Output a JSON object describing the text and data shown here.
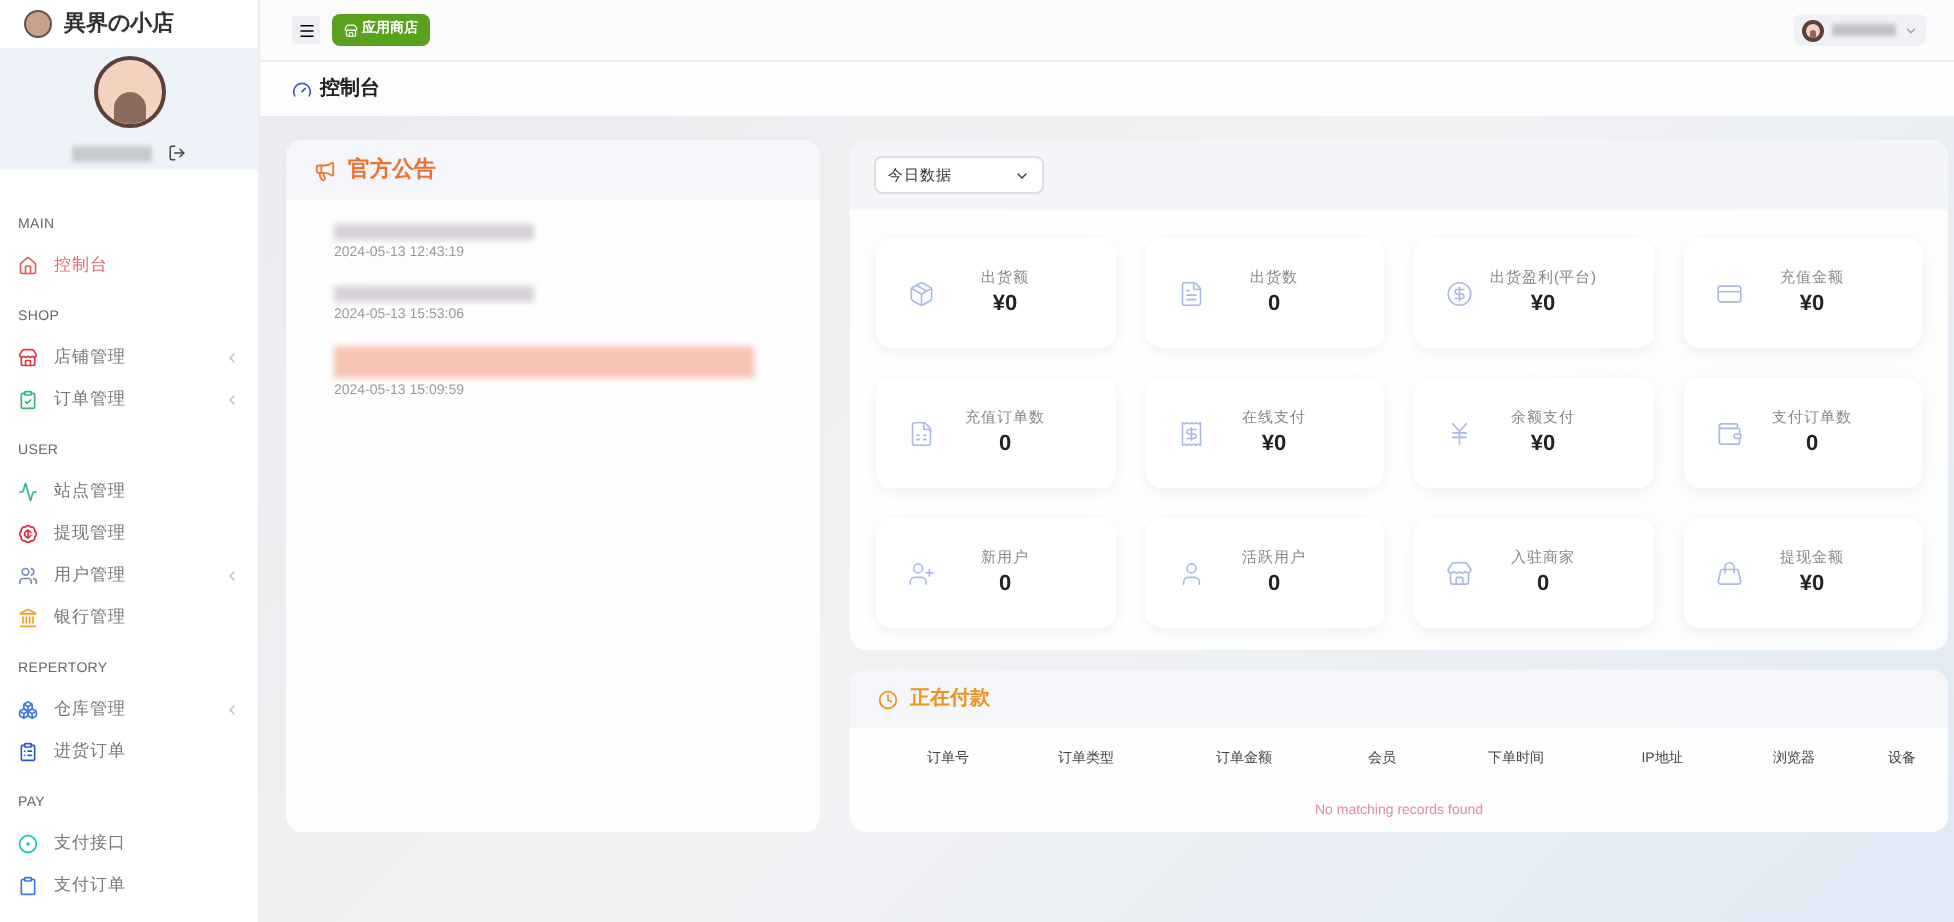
{
  "brand": {
    "title": "異界の小店"
  },
  "topbar": {
    "store_button": "应用商店"
  },
  "breadcrumb": {
    "title": "控制台"
  },
  "sidebar": {
    "sections": [
      {
        "heading": "MAIN",
        "items": [
          {
            "label": "控制台",
            "selected": true,
            "expandable": false,
            "color": "#e05a5a"
          }
        ]
      },
      {
        "heading": "SHOP",
        "items": [
          {
            "label": "店铺管理",
            "selected": false,
            "expandable": true,
            "color": "#e0383e"
          },
          {
            "label": "订单管理",
            "selected": false,
            "expandable": true,
            "color": "#2fb87a"
          }
        ]
      },
      {
        "heading": "USER",
        "items": [
          {
            "label": "站点管理",
            "selected": false,
            "expandable": false,
            "color": "#2fb87a"
          },
          {
            "label": "提现管理",
            "selected": false,
            "expandable": false,
            "color": "#e0283e"
          },
          {
            "label": "用户管理",
            "selected": false,
            "expandable": true,
            "color": "#7a8ab8"
          },
          {
            "label": "银行管理",
            "selected": false,
            "expandable": false,
            "color": "#f0a020"
          }
        ]
      },
      {
        "heading": "REPERTORY",
        "items": [
          {
            "label": "仓库管理",
            "selected": false,
            "expandable": true,
            "color": "#3a7ae0"
          },
          {
            "label": "进货订单",
            "selected": false,
            "expandable": false,
            "color": "#2a56d0"
          }
        ]
      },
      {
        "heading": "PAY",
        "items": [
          {
            "label": "支付接口",
            "selected": false,
            "expandable": false,
            "color": "#1cc0c0"
          },
          {
            "label": "支付订单",
            "selected": false,
            "expandable": false,
            "color": "#3a7ae0"
          }
        ]
      }
    ]
  },
  "announcements": {
    "title": "官方公告",
    "items": [
      {
        "time": "2024-05-13 12:43:19",
        "highlight": false
      },
      {
        "time": "2024-05-13 15:53:06",
        "highlight": false
      },
      {
        "time": "2024-05-13 15:09:59",
        "highlight": true
      }
    ]
  },
  "stats": {
    "range": "今日数据",
    "cards": [
      {
        "kind": "box",
        "label": "出货额",
        "value": "¥0"
      },
      {
        "kind": "doc",
        "label": "出货数",
        "value": "0"
      },
      {
        "kind": "dollar",
        "label": "出货盈利(平台)",
        "value": "¥0"
      },
      {
        "kind": "card",
        "label": "充值金额",
        "value": "¥0"
      },
      {
        "kind": "docyen",
        "label": "充值订单数",
        "value": "0"
      },
      {
        "kind": "receipt",
        "label": "在线支付",
        "value": "¥0"
      },
      {
        "kind": "yen",
        "label": "余额支付",
        "value": "¥0"
      },
      {
        "kind": "wallet",
        "label": "支付订单数",
        "value": "0"
      },
      {
        "kind": "userplus",
        "label": "新用户",
        "value": "0"
      },
      {
        "kind": "user",
        "label": "活跃用户",
        "value": "0"
      },
      {
        "kind": "store",
        "label": "入驻商家",
        "value": "0"
      },
      {
        "kind": "bag",
        "label": "提现金额",
        "value": "¥0"
      }
    ]
  },
  "paying": {
    "title": "正在付款",
    "columns": [
      "订单号",
      "订单类型",
      "订单金额",
      "会员",
      "下单时间",
      "IP地址",
      "浏览器",
      "设备"
    ],
    "empty": "No matching records found"
  }
}
